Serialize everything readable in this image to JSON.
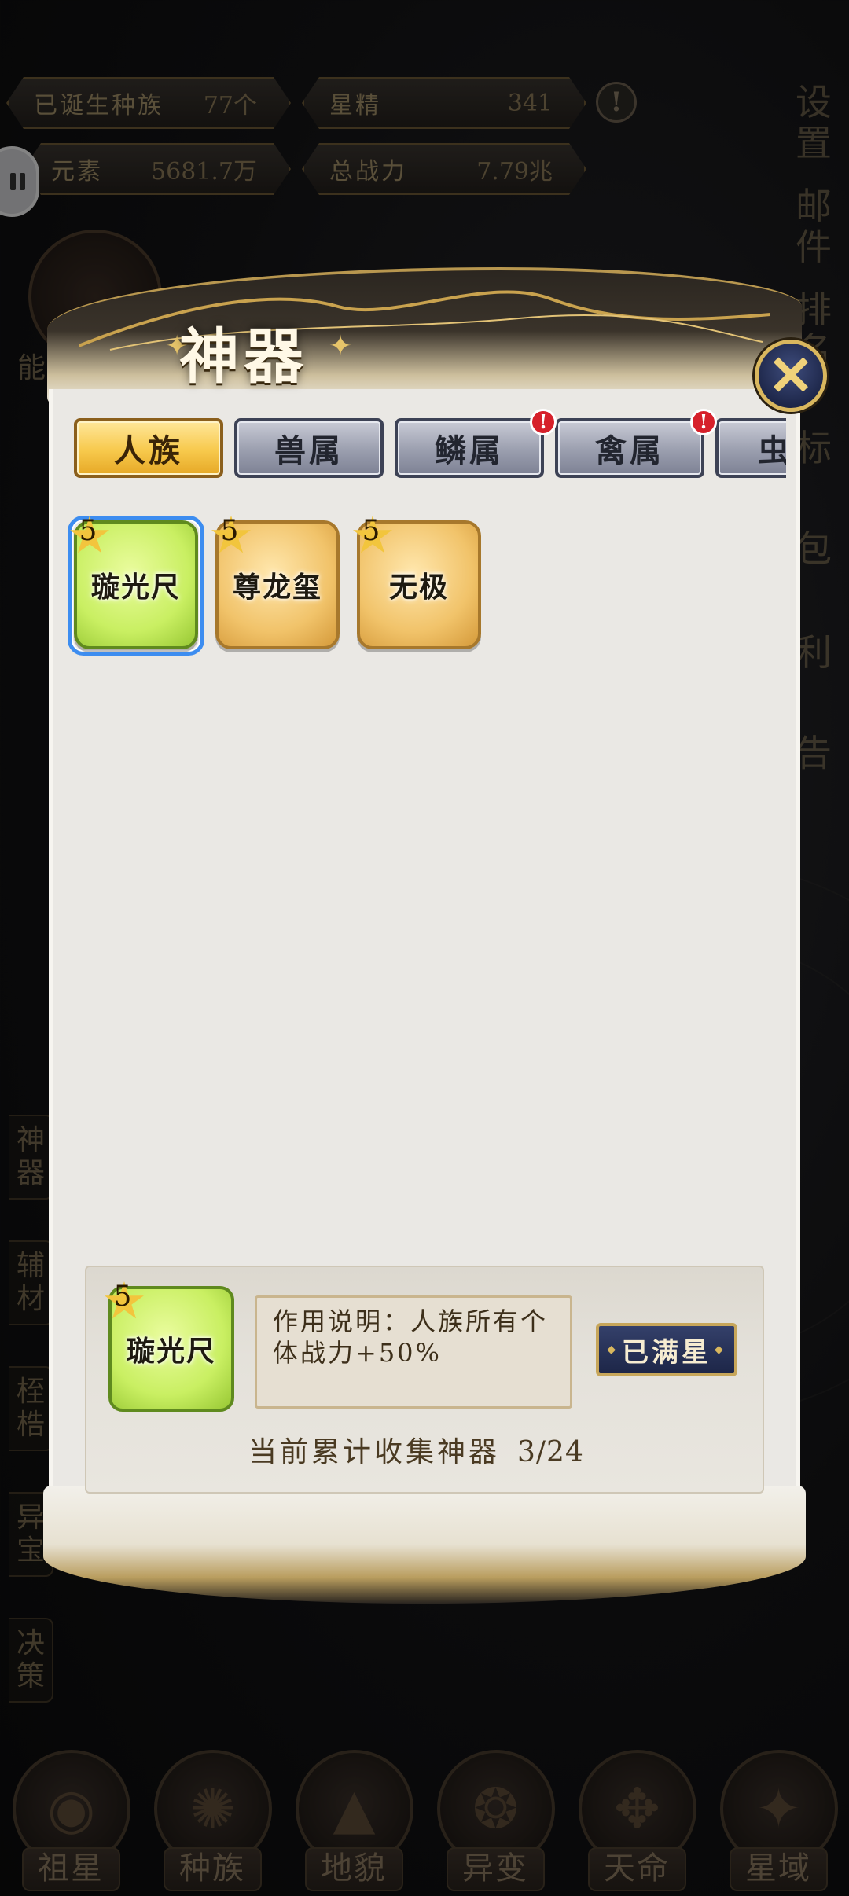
{
  "resources": {
    "races_label": "已诞生种族",
    "races_value": "77个",
    "star_essence_label": "星精",
    "star_essence_value": "341",
    "elements_label": "元素",
    "elements_value": "5681.7万",
    "total_power_label": "总战力",
    "total_power_value": "7.79兆"
  },
  "right_menu": [
    "设\n置",
    "邮\n件",
    "排\n名",
    "标",
    "包",
    "利",
    "告"
  ],
  "left_menu": [
    {
      "label": "神\n器"
    },
    {
      "label": "辅\n材"
    },
    {
      "label": "桎\n梏"
    },
    {
      "label": "异\n宝"
    },
    {
      "label": "决\n策"
    }
  ],
  "left_top_label": "能",
  "bottom_nav": [
    {
      "label": "祖星",
      "icon": "planet-icon"
    },
    {
      "label": "种族",
      "icon": "race-icon"
    },
    {
      "label": "地貌",
      "icon": "terrain-icon"
    },
    {
      "label": "异变",
      "icon": "mutation-icon"
    },
    {
      "label": "天命",
      "icon": "destiny-icon"
    },
    {
      "label": "星域",
      "icon": "star-domain-icon"
    }
  ],
  "dialog": {
    "title": "神器",
    "tabs": [
      {
        "label": "人族",
        "active": true,
        "badge": false
      },
      {
        "label": "兽属",
        "active": false,
        "badge": false
      },
      {
        "label": "鳞属",
        "active": false,
        "badge": true
      },
      {
        "label": "禽属",
        "active": false,
        "badge": true
      },
      {
        "label": "虫",
        "active": false,
        "badge": false
      }
    ],
    "badge_text": "!",
    "artifacts": [
      {
        "name": "璇光尺",
        "stars": "5",
        "rarity": "green",
        "selected": true
      },
      {
        "name": "尊龙玺",
        "stars": "5",
        "rarity": "gold",
        "selected": false
      },
      {
        "name": "无极",
        "stars": "5",
        "rarity": "gold",
        "selected": false
      }
    ],
    "detail": {
      "name": "璇光尺",
      "stars": "5",
      "description": "作用说明：人族所有个体战力+50%",
      "status_button": "已满星",
      "collect_label": "当前累计收集神器",
      "collect_count": "3/24"
    }
  },
  "colors": {
    "accent_gold": "#f7c94c",
    "card_green": "#c9ef62",
    "card_gold": "#f1c36a",
    "selection_blue": "#3d8df0",
    "badge_red": "#d6202a"
  }
}
